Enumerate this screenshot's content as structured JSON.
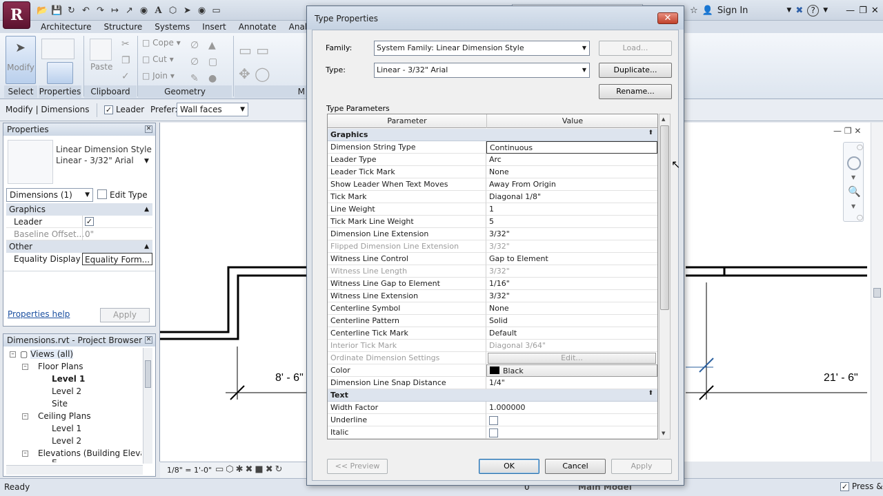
{
  "qat_icons": [
    "open-icon",
    "save-icon",
    "sync-icon",
    "undo-icon",
    "redo-icon",
    "measure-icon",
    "dimension-icon",
    "tag-icon",
    "text-icon",
    "3d-view-icon",
    "section-icon",
    "elevation-icon",
    "close-hidden-icon"
  ],
  "user": {
    "sign_in": "Sign In"
  },
  "ribbon": {
    "tabs": [
      "Architecture",
      "Structure",
      "Systems",
      "Insert",
      "Annotate",
      "Analyze"
    ],
    "modify_label": "Modify",
    "paste_label": "Paste",
    "cope_label": "Cope",
    "cut_label": "Cut",
    "join_label": "Join",
    "panels": {
      "select": "Select",
      "properties": "Properties",
      "clipboard": "Clipboard",
      "geometry": "Geometry",
      "modify_short": "M"
    }
  },
  "options_bar": {
    "context": "Modify | Dimensions",
    "leader_label": "Leader",
    "leader_checked": "✓",
    "prefer_label": "Prefer:",
    "prefer_value": "Wall faces"
  },
  "properties": {
    "title": "Properties",
    "type_name_line1": "Linear Dimension Style",
    "type_name_line2": "Linear - 3/32\" Arial",
    "filter": "Dimensions (1)",
    "edit_type": "Edit Type",
    "groups": [
      {
        "name": "Graphics",
        "rows": [
          {
            "param": "Leader",
            "value": "✓"
          },
          {
            "param": "Baseline Offset...",
            "value": "0\""
          }
        ]
      },
      {
        "name": "Other",
        "rows": [
          {
            "param": "Equality Display",
            "value": "Equality Form..."
          }
        ]
      }
    ],
    "help_link": "Properties help",
    "apply": "Apply"
  },
  "browser": {
    "title": "Dimensions.rvt - Project Browser",
    "items": [
      {
        "label": "Views (all)"
      },
      {
        "label": "Floor Plans"
      },
      {
        "label": "Level 1"
      },
      {
        "label": "Level 2"
      },
      {
        "label": "Site"
      },
      {
        "label": "Ceiling Plans"
      },
      {
        "label": "Level 1"
      },
      {
        "label": "Level 2"
      },
      {
        "label": "Elevations (Building Elevatio"
      },
      {
        "label": "E..."
      }
    ]
  },
  "drawing": {
    "dim_left": "8' - 6\"",
    "dim_right": "21' - 6\""
  },
  "view_bar": {
    "scale": "1/8\" = 1'-0\""
  },
  "status": {
    "ready": "Ready",
    "coords": "0",
    "model": "Main Model",
    "press": "Press &"
  },
  "dialog": {
    "title": "Type Properties",
    "close": "✕",
    "family_label": "Family:",
    "family_value": "System Family: Linear Dimension Style",
    "type_label": "Type:",
    "type_value": "Linear - 3/32\" Arial",
    "load": "Load...",
    "duplicate": "Duplicate...",
    "rename": "Rename...",
    "section_label": "Type Parameters",
    "col_param": "Parameter",
    "col_value": "Value",
    "groups": [
      {
        "name": "Graphics",
        "rows": [
          {
            "param": "Dimension String Type",
            "value": "Continuous"
          },
          {
            "param": "Leader Type",
            "value": "Arc"
          },
          {
            "param": "Leader Tick Mark",
            "value": "None"
          },
          {
            "param": "Show Leader When Text Moves",
            "value": "Away From Origin"
          },
          {
            "param": "Tick Mark",
            "value": "Diagonal 1/8\""
          },
          {
            "param": "Line Weight",
            "value": "1"
          },
          {
            "param": "Tick Mark Line Weight",
            "value": "5"
          },
          {
            "param": "Dimension Line Extension",
            "value": "3/32\""
          },
          {
            "param": "Flipped Dimension Line Extension",
            "value": "3/32\""
          },
          {
            "param": "Witness Line Control",
            "value": "Gap to Element"
          },
          {
            "param": "Witness Line Length",
            "value": "3/32\""
          },
          {
            "param": "Witness Line Gap to Element",
            "value": "1/16\""
          },
          {
            "param": "Witness Line Extension",
            "value": "3/32\""
          },
          {
            "param": "Centerline Symbol",
            "value": "None"
          },
          {
            "param": "Centerline Pattern",
            "value": "Solid"
          },
          {
            "param": "Centerline Tick Mark",
            "value": "Default"
          },
          {
            "param": "Interior Tick Mark",
            "value": "Diagonal 3/64\""
          },
          {
            "param": "Ordinate Dimension Settings",
            "value": "Edit..."
          },
          {
            "param": "Color",
            "value": "Black"
          },
          {
            "param": "Dimension Line Snap Distance",
            "value": "1/4\""
          }
        ]
      },
      {
        "name": "Text",
        "rows": [
          {
            "param": "Width Factor",
            "value": "1.000000"
          },
          {
            "param": "Underline",
            "value": ""
          },
          {
            "param": "Italic",
            "value": ""
          }
        ]
      }
    ],
    "preview": "<< Preview",
    "ok": "OK",
    "cancel": "Cancel",
    "apply": "Apply"
  },
  "colors": {
    "accent": "#2b6ea8",
    "group_bg": "#dde4ee",
    "app_button": "#7a1f44",
    "close_button": "#c0412b"
  }
}
